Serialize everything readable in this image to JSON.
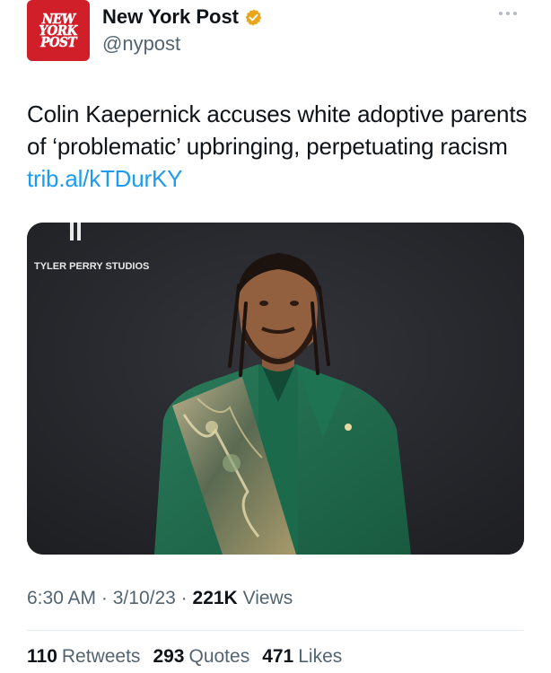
{
  "author": {
    "avatar_lines": [
      "NEW",
      "YORK",
      "POST"
    ],
    "display_name": "New York Post",
    "handle": "@nypost",
    "verified_badge_color": "#e8a618",
    "verified_icon": "verified-badge-icon"
  },
  "more_icon": "ellipsis-icon",
  "tweet": {
    "text": "Colin Kaepernick accuses white adoptive parents of ‘problematic’ upbringing, perpetuating racism",
    "link": "trib.al/kTDurKY"
  },
  "media": {
    "backdrop_text": "TYLER PERRY STUDIOS",
    "backdrop_color": "#26272b",
    "suit_color": "#1f6b4e"
  },
  "meta": {
    "time": "6:30 AM",
    "date": "3/10/23",
    "separator": "·",
    "views_count": "221K",
    "views_label": "Views"
  },
  "stats": {
    "retweets_count": "110",
    "retweets_label": "Retweets",
    "quotes_count": "293",
    "quotes_label": "Quotes",
    "likes_count": "471",
    "likes_label": "Likes"
  },
  "colors": {
    "link": "#1d9bf0",
    "secondary_text": "#536471",
    "primary_text": "#0f1419",
    "brand_red": "#d11f2a"
  }
}
